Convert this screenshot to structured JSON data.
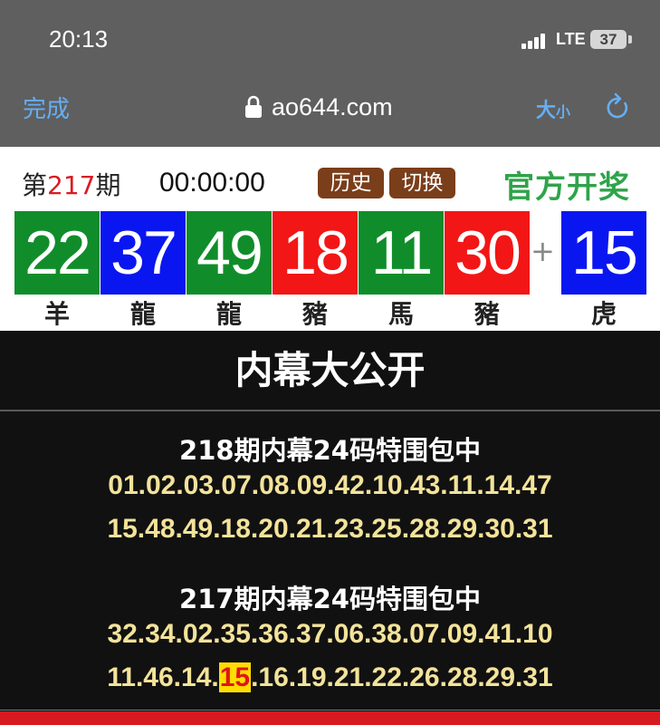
{
  "status_bar": {
    "time": "20:13",
    "network": "LTE",
    "battery": "37"
  },
  "nav": {
    "done_label": "完成",
    "url": "ao644.com",
    "size_label_big": "大",
    "size_label_small": "小"
  },
  "lottery": {
    "period_prefix": "第",
    "period_number": "217",
    "period_suffix": "期",
    "countdown": "00:00:00",
    "history_label": "历史",
    "switch_label": "切换",
    "official_label": "官方开奖",
    "balls": [
      {
        "number": "22",
        "zodiac": "羊",
        "color": "#108d2a"
      },
      {
        "number": "37",
        "zodiac": "龍",
        "color": "#0a16f0"
      },
      {
        "number": "49",
        "zodiac": "龍",
        "color": "#108d2a"
      },
      {
        "number": "18",
        "zodiac": "豬",
        "color": "#f21616"
      },
      {
        "number": "11",
        "zodiac": "馬",
        "color": "#108d2a"
      },
      {
        "number": "30",
        "zodiac": "豬",
        "color": "#f21616"
      }
    ],
    "plus": "+",
    "special": {
      "number": "15",
      "zodiac": "虎",
      "color": "#0a16f0"
    }
  },
  "reveal": {
    "title": "内幕大公开",
    "block1": {
      "heading": "218期内幕24码特围包中",
      "line1": "01.02.03.07.08.09.42.10.43.11.14.47",
      "line2": "15.48.49.18.20.21.23.25.28.29.30.31"
    },
    "block2": {
      "heading": "217期内幕24码特围包中",
      "line1": "32.34.02.35.36.37.06.38.07.09.41.10",
      "line2_before": "11.46.14.",
      "line2_hit": "15",
      "line2_after": ".16.19.21.22.26.28.29.31"
    }
  }
}
